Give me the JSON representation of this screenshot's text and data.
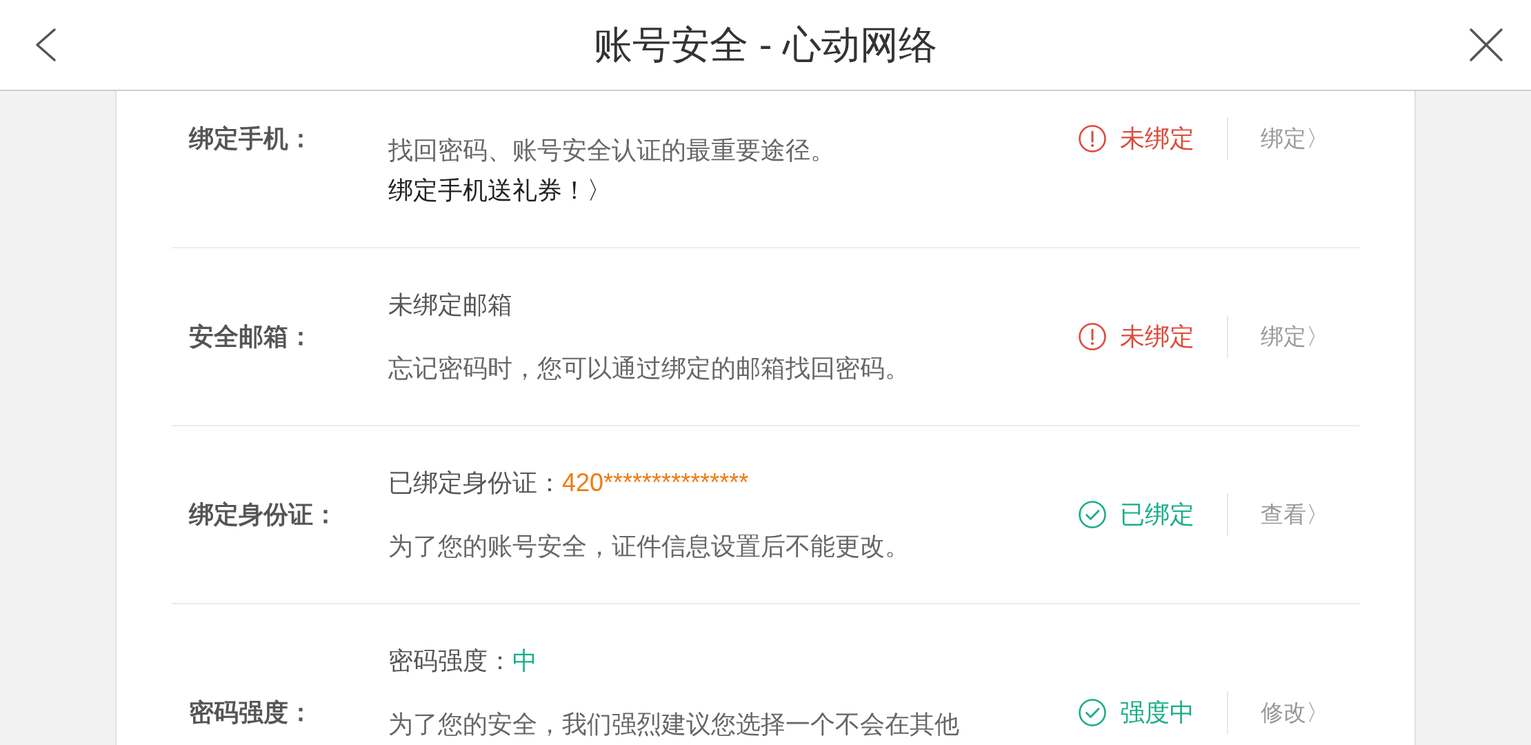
{
  "header": {
    "title": "账号安全 - 心动网络"
  },
  "rows": [
    {
      "label": "绑定手机：",
      "description": [
        {
          "kind": "plain",
          "text": "找回密码、账号安全认证的最重要途径。"
        },
        {
          "kind": "link",
          "text": "绑定手机送礼券！〉"
        }
      ],
      "status": {
        "kind": "warning",
        "text": "未绑定"
      },
      "action": "绑定〉"
    },
    {
      "label": "安全邮箱：",
      "status_line": {
        "text": "未绑定邮箱"
      },
      "description": [
        {
          "kind": "plain",
          "text": "忘记密码时，您可以通过绑定的邮箱找回密码。"
        }
      ],
      "status": {
        "kind": "warning",
        "text": "未绑定"
      },
      "action": "绑定〉"
    },
    {
      "label": "绑定身份证：",
      "status_line": {
        "text": "已绑定身份证：",
        "value": "420***************",
        "color": "#ef7b12"
      },
      "description": [
        {
          "kind": "plain",
          "text": "为了您的账号安全，证件信息设置后不能更改。"
        }
      ],
      "status": {
        "kind": "ok",
        "text": "已绑定"
      },
      "action": "查看〉"
    },
    {
      "label": "密码强度：",
      "status_line": {
        "text": "密码强度：",
        "value": "中",
        "color": "#1aae8a"
      },
      "description": [
        {
          "kind": "plain",
          "text": "为了您的安全，我们强烈建议您选择一个不会在其他"
        }
      ],
      "status": {
        "kind": "ok",
        "text": "强度中"
      },
      "action": "修改〉"
    }
  ]
}
